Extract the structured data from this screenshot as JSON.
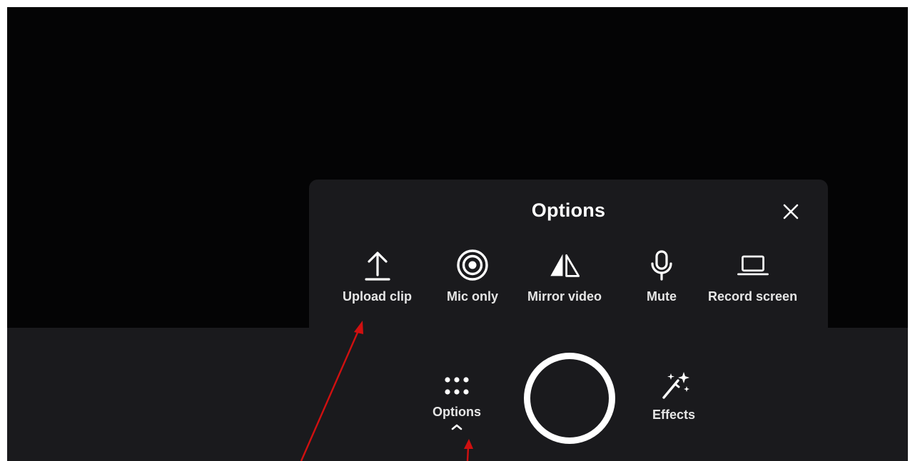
{
  "panel": {
    "title": "Options",
    "close_icon": "close-icon",
    "items": [
      {
        "label": "Upload clip",
        "icon": "upload-icon"
      },
      {
        "label": "Mic only",
        "icon": "target-icon"
      },
      {
        "label": "Mirror video",
        "icon": "mirror-icon"
      },
      {
        "label": "Mute",
        "icon": "microphone-icon"
      },
      {
        "label": "Record screen",
        "icon": "laptop-icon"
      }
    ]
  },
  "controls": {
    "options_label": "Options",
    "effects_label": "Effects",
    "options_icon": "grid-dots-icon",
    "effects_icon": "magic-wand-icon",
    "record_icon": "record-button"
  },
  "colors": {
    "background": "#040404",
    "panel": "#1a1a1d",
    "text": "#ffffff",
    "annotation": "#d01010"
  }
}
